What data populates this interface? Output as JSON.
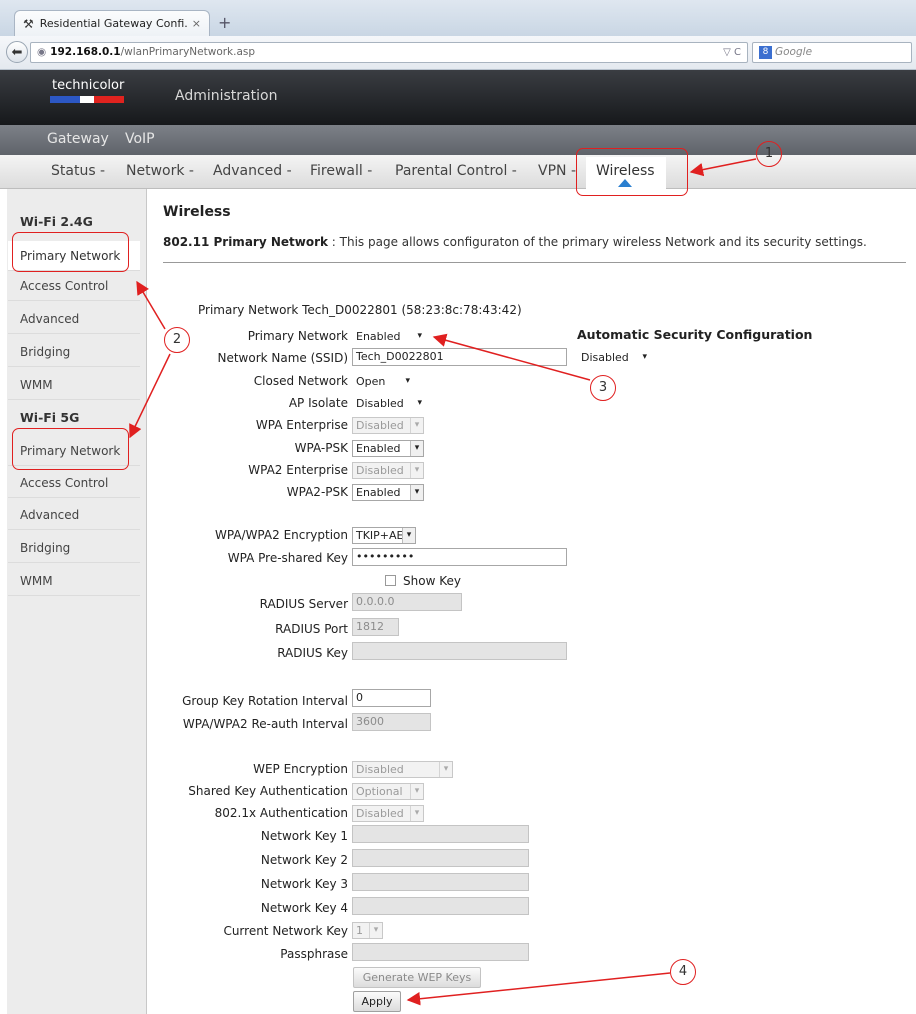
{
  "browser": {
    "tab_title": "Residential Gateway Confi...",
    "tab_close": "×",
    "new_tab": "+",
    "url_host": "192.168.0.1",
    "url_path": "/wlanPrimaryNetwork.asp",
    "url_controls": "▽ C",
    "search_placeholder": "Google"
  },
  "brand": {
    "logo_text": "technicolor",
    "logo_colors": [
      "#2c57c4",
      "#2c57c4",
      "#ffffff",
      "#e0231f",
      "#e0231f"
    ],
    "admin_label": "Administration"
  },
  "tier1": {
    "gateway": "Gateway",
    "voip": "VoIP"
  },
  "tier2": {
    "status": "Status -",
    "network": "Network -",
    "advanced": "Advanced -",
    "firewall": "Firewall -",
    "parental": "Parental Control -",
    "vpn": "VPN -",
    "wireless": "Wireless"
  },
  "sidebar": {
    "wifi24_heading": "Wi-Fi 2.4G",
    "wifi24_items": [
      "Primary Network",
      "Access Control",
      "Advanced",
      "Bridging",
      "WMM"
    ],
    "wifi5_heading": "Wi-Fi 5G",
    "wifi5_items": [
      "Primary Network",
      "Access Control",
      "Advanced",
      "Bridging",
      "WMM"
    ]
  },
  "main": {
    "title": "Wireless",
    "desc_bold": "802.11 Primary Network",
    "desc_text": " : This page allows configuraton of the primary wireless Network and its security settings."
  },
  "form": {
    "network_heading": "Primary Network Tech_D0022801 (58:23:8c:78:43:42)",
    "primary_network_label": "Primary Network",
    "primary_network_value": "Enabled",
    "ssid_label": "Network Name (SSID)",
    "ssid_value": "Tech_D0022801",
    "closed_network_label": "Closed Network",
    "closed_network_value": "Open",
    "ap_isolate_label": "AP Isolate",
    "ap_isolate_value": "Disabled",
    "wpa_enterprise_label": "WPA Enterprise",
    "wpa_enterprise_value": "Disabled",
    "wpa_psk_label": "WPA-PSK",
    "wpa_psk_value": "Enabled",
    "wpa2_enterprise_label": "WPA2 Enterprise",
    "wpa2_enterprise_value": "Disabled",
    "wpa2_psk_label": "WPA2-PSK",
    "wpa2_psk_value": "Enabled",
    "encryption_label": "WPA/WPA2 Encryption",
    "encryption_value": "TKIP+AES",
    "psk_label": "WPA Pre-shared Key",
    "psk_value": "•••••••••",
    "show_key_label": "Show Key",
    "radius_server_label": "RADIUS Server",
    "radius_server_value": "0.0.0.0",
    "radius_port_label": "RADIUS Port",
    "radius_port_value": "1812",
    "radius_key_label": "RADIUS Key",
    "radius_key_value": "",
    "group_key_label": "Group Key Rotation Interval",
    "group_key_value": "0",
    "reauth_label": "WPA/WPA2 Re-auth Interval",
    "reauth_value": "3600",
    "wep_encryption_label": "WEP Encryption",
    "wep_encryption_value": "Disabled",
    "shared_key_auth_label": "Shared Key Authentication",
    "shared_key_auth_value": "Optional",
    "auth_8021x_label": "802.1x Authentication",
    "auth_8021x_value": "Disabled",
    "network_key1_label": "Network Key 1",
    "network_key2_label": "Network Key 2",
    "network_key3_label": "Network Key 3",
    "network_key4_label": "Network Key 4",
    "current_key_label": "Current Network Key",
    "current_key_value": "1",
    "passphrase_label": "Passphrase",
    "generate_wep_label": "Generate WEP Keys",
    "apply_label": "Apply",
    "auto_security_title": "Automatic Security Configuration",
    "auto_security_value": "Disabled"
  },
  "annotations": {
    "c1": "1",
    "c2": "2",
    "c3": "3",
    "c4": "4",
    "annotation_color": "#e02020"
  },
  "icons": {
    "tools_icon": "⚒",
    "back_icon": "⬅",
    "globe_icon": "◉",
    "dropdown_icon": "▾",
    "search_engine_icon": "8"
  }
}
